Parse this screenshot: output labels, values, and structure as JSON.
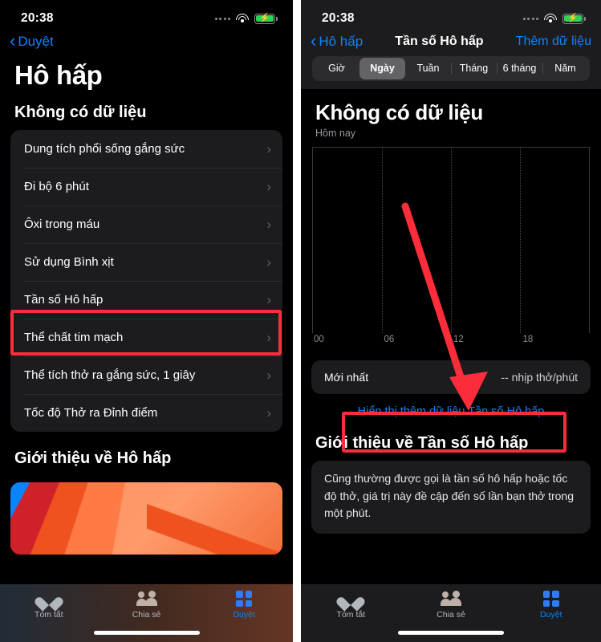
{
  "status_bar": {
    "time": "20:38",
    "wifi_icon": "wifi-icon",
    "battery_icon": "battery-charging-icon",
    "signal_icon": "cellular-dots-icon"
  },
  "left_screen": {
    "back_label": "Duyệt",
    "title": "Hô hấp",
    "section_no_data": "Không có dữ liệu",
    "items": [
      {
        "label": "Dung tích phổi sống gắng sức"
      },
      {
        "label": "Đi bộ 6 phút"
      },
      {
        "label": "Ôxi trong máu"
      },
      {
        "label": "Sử dụng Bình xịt"
      },
      {
        "label": "Tần số Hô hấp"
      },
      {
        "label": "Thể chất tim mạch"
      },
      {
        "label": "Thể tích thở ra gắng sức, 1 giây"
      },
      {
        "label": "Tốc độ Thở ra Đỉnh điểm"
      }
    ],
    "about_heading": "Giới thiệu về Hô hấp"
  },
  "right_screen": {
    "back_label": "Hô hấp",
    "nav_title": "Tần số Hô hấp",
    "nav_action": "Thêm dữ liệu",
    "segments": [
      "Giờ",
      "Ngày",
      "Tuần",
      "Tháng",
      "6 tháng",
      "Năm"
    ],
    "selected_segment": "Ngày",
    "chart_heading": "Không có dữ liệu",
    "chart_sub": "Hôm nay",
    "latest_label": "Mới nhất",
    "latest_value": "-- nhịp thở/phút",
    "show_more_link": "Hiển thị thêm dữ liệu Tần số Hô hấp",
    "about_heading": "Giới thiệu về Tần số Hô hấp",
    "about_body": "Cũng thường được gọi là tần số hô hấp hoặc tốc độ thở, giá trị này đề cập đến số lần bạn thở trong một phút."
  },
  "tab_bar": {
    "tabs": [
      {
        "label": "Tóm tắt",
        "icon": "heart-icon",
        "active": false
      },
      {
        "label": "Chia sẻ",
        "icon": "people-icon",
        "active": false
      },
      {
        "label": "Duyệt",
        "icon": "grid-icon",
        "active": true
      }
    ]
  },
  "chart_data": {
    "type": "line",
    "title": "Không có dữ liệu",
    "subtitle": "Hôm nay",
    "xlabel": "",
    "ylabel": "nhịp thở/phút",
    "x_tick_labels": [
      "00",
      "06",
      "12",
      "18"
    ],
    "x_tick_values": [
      0,
      6,
      12,
      18
    ],
    "xlim": [
      0,
      24
    ],
    "series": [
      {
        "name": "Tần số Hô hấp",
        "values": []
      }
    ],
    "grid": "vertical-dotted",
    "legend": "none",
    "note": "Empty chart – no data points plotted"
  },
  "annotations": {
    "highlight_color": "#fc2d3b",
    "boxes": [
      {
        "name": "left-list-item-highlight",
        "target": "Tần số Hô hấp"
      },
      {
        "name": "right-show-more-highlight",
        "target": "Hiển thị thêm dữ liệu Tần số Hô hấp"
      }
    ],
    "arrow": {
      "name": "pointer-arrow",
      "from": "chart-area",
      "to": "show-more-link"
    }
  }
}
